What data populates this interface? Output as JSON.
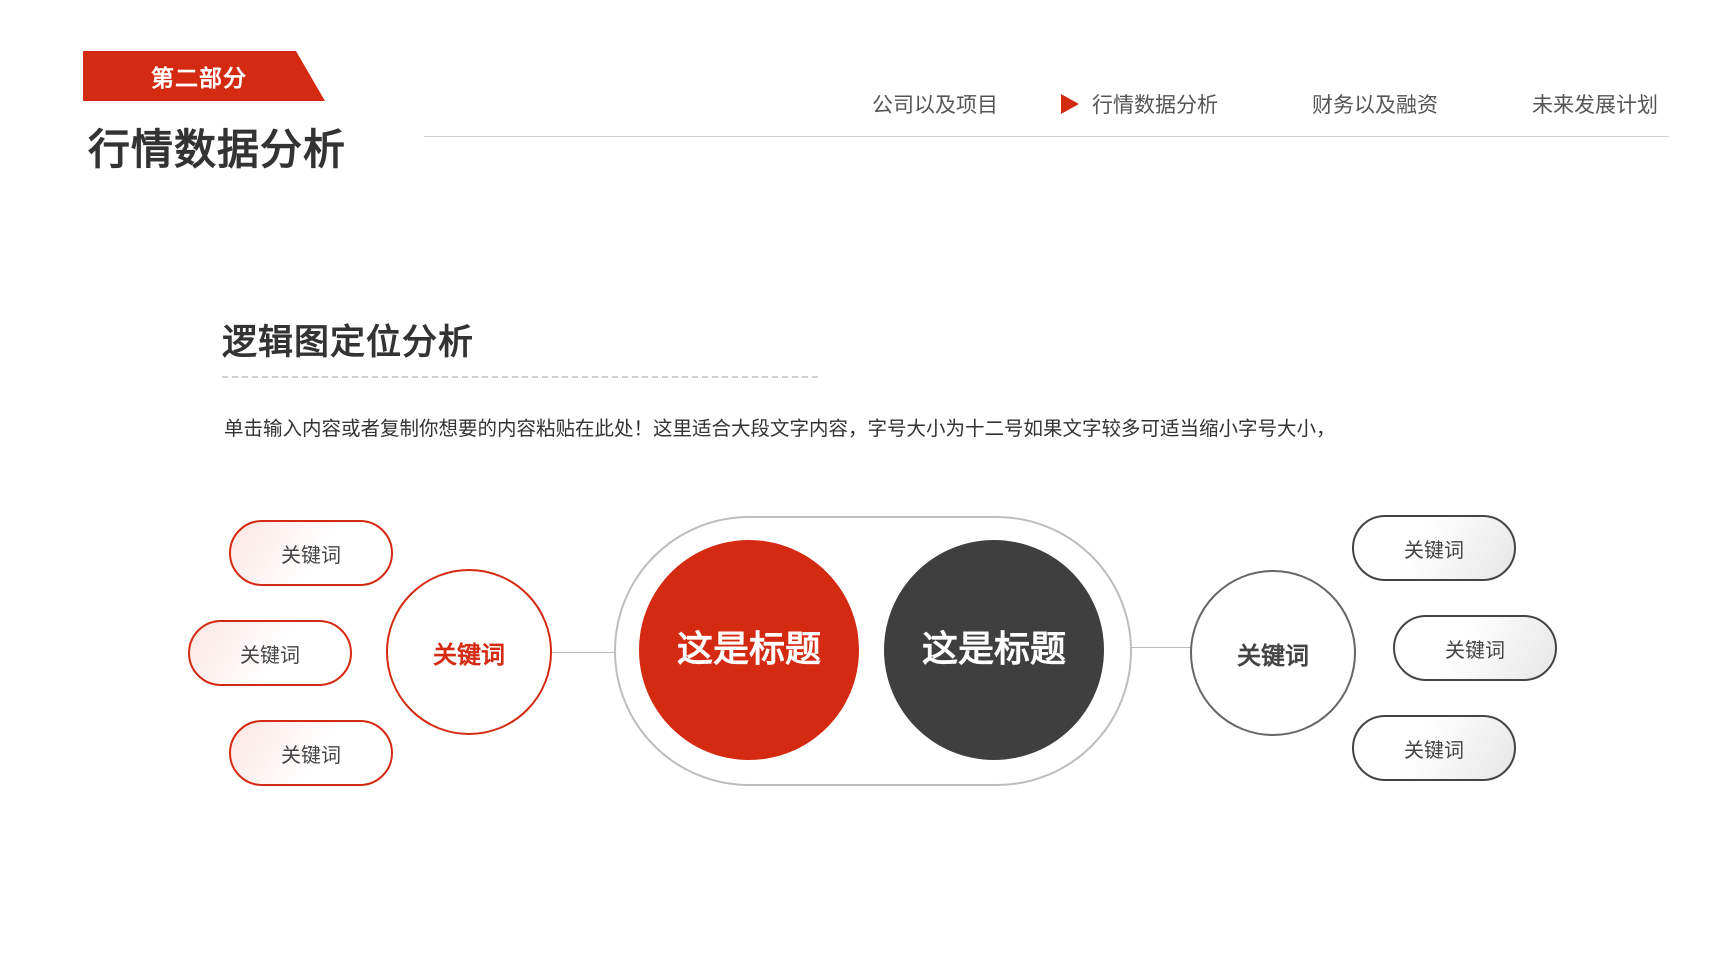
{
  "header": {
    "section_tag": "第二部分",
    "section_title": "行情数据分析"
  },
  "nav": {
    "items": [
      "公司以及项目",
      "行情数据分析",
      "财务以及融资",
      "未来发展计划"
    ],
    "active_index": 1
  },
  "content": {
    "heading": "逻辑图定位分析",
    "description": "单击输入内容或者复制你想要的内容粘贴在此处！这里适合大段文字内容，字号大小为十二号如果文字较多可适当缩小字号大小，"
  },
  "diagram": {
    "center_left": "这是标题",
    "center_right": "这是标题",
    "left_hub": "关键词",
    "right_hub": "关键词",
    "left_keywords": [
      "关键词",
      "关键词",
      "关键词"
    ],
    "right_keywords": [
      "关键词",
      "关键词",
      "关键词"
    ]
  },
  "colors": {
    "accent": "#d42a12",
    "dark": "#3f3f3f"
  }
}
